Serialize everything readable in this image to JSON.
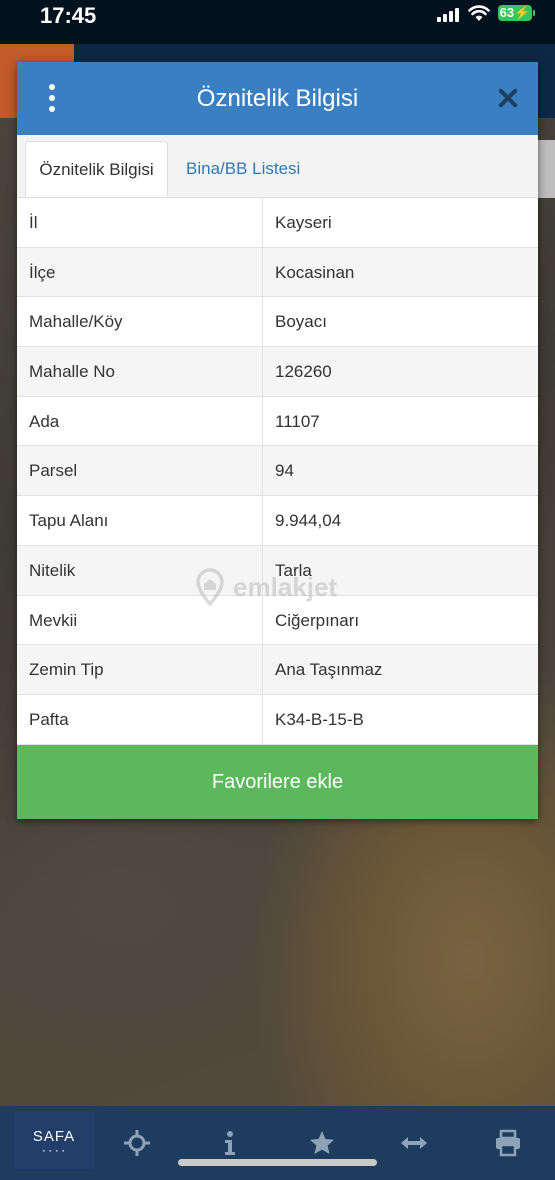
{
  "status_bar": {
    "time": "17:45",
    "battery": "63"
  },
  "modal": {
    "title": "Öznitelik Bilgisi",
    "tabs": [
      {
        "label": "Öznitelik Bilgisi",
        "active": true
      },
      {
        "label": "Bina/BB Listesi",
        "active": false
      }
    ],
    "rows": [
      {
        "key": "İl",
        "value": "Kayseri"
      },
      {
        "key": "İlçe",
        "value": "Kocasinan"
      },
      {
        "key": "Mahalle/Köy",
        "value": "Boyacı"
      },
      {
        "key": "Mahalle No",
        "value": "126260"
      },
      {
        "key": "Ada",
        "value": "11107"
      },
      {
        "key": "Parsel",
        "value": "94"
      },
      {
        "key": "Tapu Alanı",
        "value": "9.944,04"
      },
      {
        "key": "Nitelik",
        "value": "Tarla"
      },
      {
        "key": "Mevkii",
        "value": "Ciğerpınarı"
      },
      {
        "key": "Zemin Tip",
        "value": "Ana Taşınmaz"
      },
      {
        "key": "Pafta",
        "value": "K34-B-15-B"
      }
    ],
    "favorite_button": "Favorilere ekle"
  },
  "watermark": "emlakjet",
  "bottom_bar": {
    "logo": "SAFA",
    "icons": [
      "crosshair-icon",
      "info-icon",
      "star-icon",
      "arrows-horizontal-icon",
      "printer-icon"
    ]
  },
  "colors": {
    "header_blue": "#3a7fc1",
    "button_green": "#5cb85c",
    "bottom_bar": "#1e3c5d",
    "tab_link": "#2f79b6"
  }
}
